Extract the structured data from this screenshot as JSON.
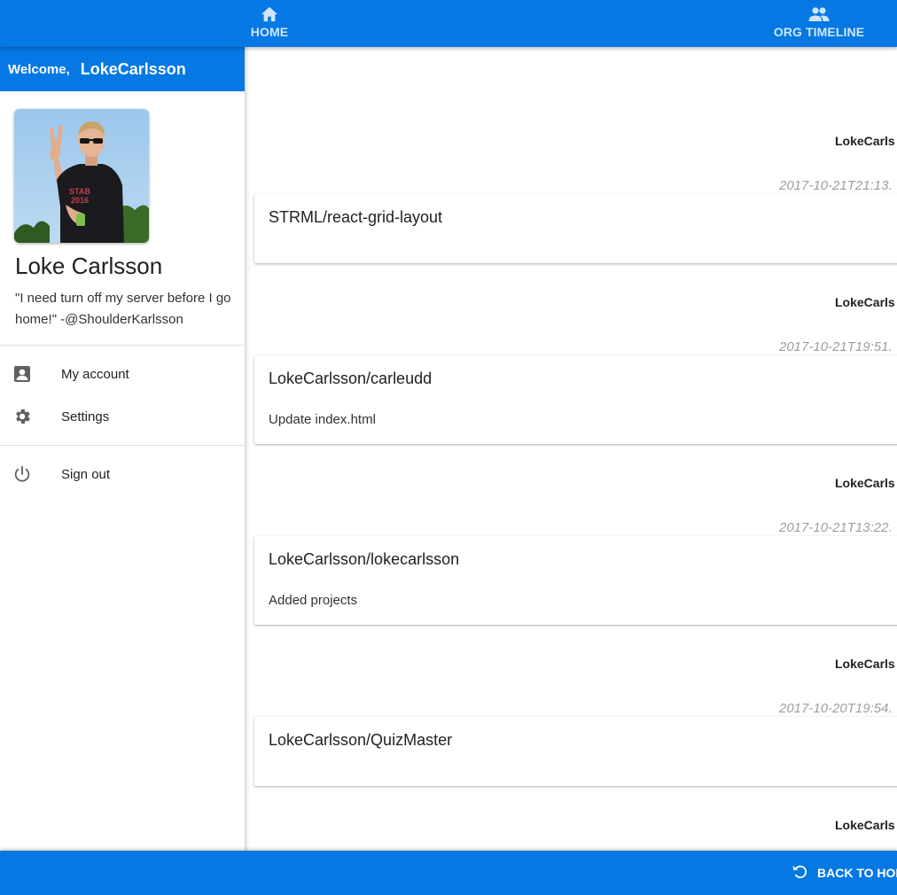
{
  "nav": {
    "home_label": "HOME",
    "org_timeline_label": "ORG TIMELINE",
    "home_icon": "home-icon",
    "org_timeline_icon": "people-icon"
  },
  "sidebar": {
    "welcome_label": "Welcome,",
    "username": "LokeCarlsson",
    "profile_name": "Loke Carlsson",
    "quote": "\"I need turn off my server before I go home!\" -@ShoulderKarlsson",
    "menu": [
      {
        "label": "My account",
        "icon": "account-box-icon"
      },
      {
        "label": "Settings",
        "icon": "gear-icon"
      },
      {
        "label": "Sign out",
        "icon": "power-icon"
      }
    ]
  },
  "feed": {
    "items": [
      {
        "user": "LokeCarls",
        "time": "2017-10-21T21:13.",
        "repo": "STRML/react-grid-layout",
        "message": ""
      },
      {
        "user": "LokeCarls",
        "time": "2017-10-21T19:51.",
        "repo": "LokeCarlsson/carleudd",
        "message": "Update index.html"
      },
      {
        "user": "LokeCarls",
        "time": "2017-10-21T13:22.",
        "repo": "LokeCarlsson/lokecarlsson",
        "message": "Added projects"
      },
      {
        "user": "LokeCarls",
        "time": "2017-10-20T19:54.",
        "repo": "LokeCarlsson/QuizMaster",
        "message": ""
      },
      {
        "user": "LokeCarls",
        "time": "",
        "repo": "",
        "message": ""
      }
    ]
  },
  "footer": {
    "back_label": "BACK TO HOM",
    "back_icon": "undo-icon"
  },
  "colors": {
    "primary": "#0678e3",
    "timestamp": "#9e9e9e"
  }
}
